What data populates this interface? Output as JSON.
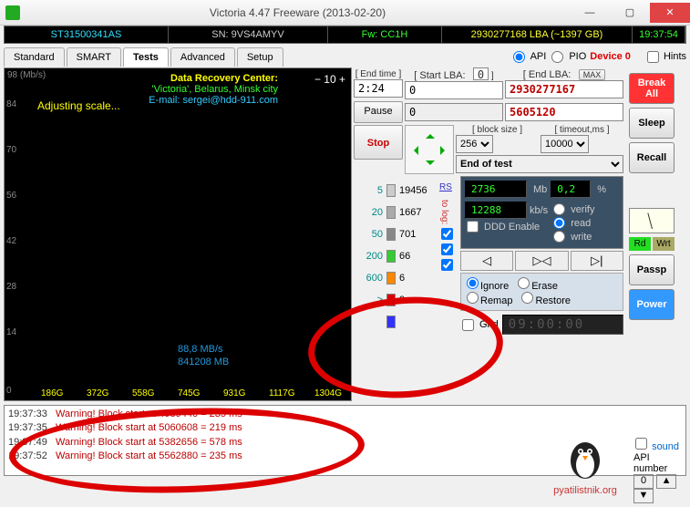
{
  "title": "Victoria 4.47  Freeware (2013-02-20)",
  "info": {
    "model": "ST31500341AS",
    "serial": "SN: 9VS4AMYV",
    "fw": "Fw: CC1H",
    "lba": "2930277168 LBA (~1397 GB)",
    "clock": "19:37:54"
  },
  "tabs": {
    "items": [
      "Standard",
      "SMART",
      "Tests",
      "Advanced",
      "Setup"
    ],
    "active": 2
  },
  "api": {
    "api": "API",
    "pio": "PIO",
    "device": "Device 0",
    "hints": "Hints"
  },
  "graph": {
    "unit": "98 (Mb/s)",
    "adjust": "Adjusting scale...",
    "zoom": "−  10  +",
    "ylabels": [
      "84",
      "70",
      "56",
      "42",
      "28",
      "14",
      "0"
    ],
    "speed1": "88,8 MB/s",
    "speed2": "841208 MB",
    "xlabels": [
      "186G",
      "372G",
      "558G",
      "745G",
      "931G",
      "1117G",
      "1304G"
    ],
    "drc1": "Data Recovery Center:",
    "drc2": "'Victoria', Belarus, Minsk city",
    "drc3": "E-mail: sergei@hdd-911.com"
  },
  "controls": {
    "endtime_lbl": "[ End time ]",
    "endtime": "2:24",
    "startlba_lbl": "[ Start LBA:",
    "startlba_idx": "0",
    "startlba": "0",
    "endlba_lbl": "[ End LBA:",
    "endlba_max": "MAX",
    "endlba": "2930277167",
    "pause": "Pause",
    "pos": "0",
    "cur": "5605120",
    "stop": "Stop",
    "block_lbl": "[ block size ]",
    "block": "256",
    "timeout_lbl": "[ timeout,ms ]",
    "timeout": "10000",
    "endtest": "End of test",
    "rs": "RS"
  },
  "legend": [
    {
      "t": "5",
      "color": "#ccc",
      "count": "19456"
    },
    {
      "t": "20",
      "color": "#aaa",
      "count": "1667"
    },
    {
      "t": "50",
      "color": "#888",
      "count": "701"
    },
    {
      "t": "200",
      "color": "#3c3",
      "count": "66"
    },
    {
      "t": "600",
      "color": "#f80",
      "count": "6"
    },
    {
      "t": ">",
      "color": "#d00",
      "count": "0"
    },
    {
      "t": "",
      "color": "#33f",
      "count": ""
    }
  ],
  "tolog": "to log:",
  "stats": {
    "mb": "2736",
    "mb_u": "Mb",
    "pct": "0,2",
    "pct_u": "%",
    "kbs": "12288",
    "kbs_u": "kb/s",
    "verify": "verify",
    "read": "read",
    "write": "write",
    "ddd": "DDD Enable"
  },
  "actions": {
    "ignore": "Ignore",
    "erase": "Erase",
    "remap": "Remap",
    "restore": "Restore",
    "grid": "Grid",
    "seg": "09:00:00"
  },
  "right": {
    "break": "Break",
    "all": "All",
    "sleep": "Sleep",
    "recall": "Recall",
    "passp": "Passp",
    "power": "Power",
    "rd": "Rd",
    "wrt": "Wrt"
  },
  "log": [
    {
      "time": "19:37:33",
      "msg": "Warning! Block start at 4989440 = 235 ms"
    },
    {
      "time": "19:37:35",
      "msg": "Warning! Block start at 5060608 = 219 ms"
    },
    {
      "time": "19:37:49",
      "msg": "Warning! Block start at 5382656 = 578 ms"
    },
    {
      "time": "19:37:52",
      "msg": "Warning! Block start at 5562880 = 235 ms"
    }
  ],
  "sidelog": {
    "sound": "sound",
    "apinum": "API number",
    "val": "0"
  },
  "watermark": "pyatilistnik.org"
}
